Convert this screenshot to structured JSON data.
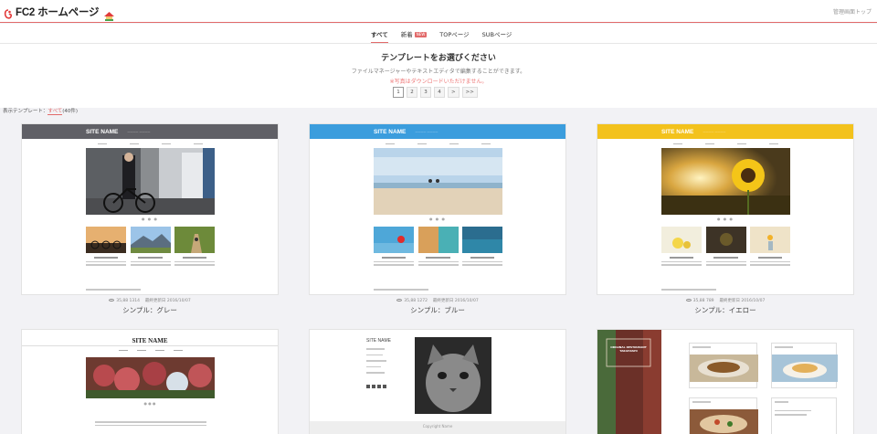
{
  "header": {
    "logo_text": "FC2 ホームページ",
    "admin_link": "管理画面トップ"
  },
  "tabs": [
    {
      "label": "すべて",
      "active": true
    },
    {
      "label": "新着",
      "badge": "NEW"
    },
    {
      "label": "TOPページ"
    },
    {
      "label": "SUBページ"
    }
  ],
  "intro": {
    "title": "テンプレートをお選びください",
    "subtitle": "ファイルマネージャーやテキストエディタで編集することができます。",
    "warning": "※写真はダウンロードいただけません。"
  },
  "pager": [
    "1",
    "2",
    "3",
    "4",
    ">",
    ">>"
  ],
  "filter": {
    "prefix": "表示テンプレート：",
    "current": "すべて",
    "count": "(40件)"
  },
  "templates": [
    {
      "site_name": "SITE NAME",
      "header_color": "#606066",
      "meta": "35,88 1314 　最終更新日 2016/10/07",
      "label": "シンプル：グレー"
    },
    {
      "site_name": "SITE NAME",
      "header_color": "#3b9ddd",
      "meta": "35,88 1272 　最終更新日 2016/10/07",
      "label": "シンプル：ブルー"
    },
    {
      "site_name": "SITE NAME",
      "header_color": "#f3c21c",
      "meta": "35,88 789 　最終更新日 2016/10/07",
      "label": "シンプル：イエロー"
    }
  ],
  "bottom": {
    "card4_title": "SITE NAME",
    "card5_title": "SITE NAME",
    "card5_footer": "Copyright Name",
    "card6_title": "ORIGINAL RESTAURANT TAKAHASHI"
  },
  "colors": {
    "accent": "#e26a6a"
  }
}
